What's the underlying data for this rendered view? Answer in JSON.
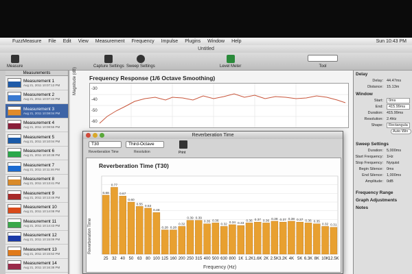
{
  "menubar": {
    "items": [
      "FuzzMeasure",
      "File",
      "Edit",
      "View",
      "Measurement",
      "Frequency",
      "Impulse",
      "Plugins",
      "Window",
      "Help"
    ],
    "clock": "Sun 10:43 PM"
  },
  "window_title": "Untitled",
  "toolbar": {
    "measure": "Measure",
    "capture_settings": "Capture Settings",
    "sweep_settings": "Sweep Settings",
    "level_meter": "Level Meter",
    "tool": "Tool"
  },
  "sidebar": {
    "header": "Measurements",
    "items": [
      {
        "name": "Measurement 1",
        "date": "Aug 21, 2011 10:07:13 PM",
        "color": "#1e5aa8"
      },
      {
        "name": "Measurement 2",
        "date": "Aug 21, 2011 10:07:43 PM",
        "color": "#3a7ad1"
      },
      {
        "name": "Measurement 3",
        "date": "Aug 21, 2011 10:08:04 PM",
        "color": "#e08a2a"
      },
      {
        "name": "Measurement 4",
        "date": "Aug 21, 2011 10:08:55 PM",
        "color": "#8a1f3a"
      },
      {
        "name": "Measurement 5",
        "date": "Aug 21, 2011 10:10:04 PM",
        "color": "#1a5aa8"
      },
      {
        "name": "Measurement 6",
        "date": "Aug 21, 2011 10:10:38 PM",
        "color": "#2aa84a"
      },
      {
        "name": "Measurement 7",
        "date": "Aug 21, 2011 10:11:46 PM",
        "color": "#1a6ad1"
      },
      {
        "name": "Measurement 8",
        "date": "Aug 21, 2011 10:13:41 PM",
        "color": "#d98a2a"
      },
      {
        "name": "Measurement 9",
        "date": "Aug 21, 2011 10:13:46 PM",
        "color": "#a82a2a"
      },
      {
        "name": "Measurement 10",
        "date": "Aug 21, 2011 10:14:08 PM",
        "color": "#d94a1a"
      },
      {
        "name": "Measurement 11",
        "date": "Aug 21, 2011 10:14:43 PM",
        "color": "#3aa84a"
      },
      {
        "name": "Measurement 12",
        "date": "Aug 21, 2011 10:15:09 PM",
        "color": "#1a3aa8"
      },
      {
        "name": "Measurement 13",
        "date": "Aug 21, 2011 10:15:52 PM",
        "color": "#e07a1a"
      },
      {
        "name": "Measurement 14",
        "date": "Aug 21, 2011 10:16:38 PM",
        "color": "#9a2a4a"
      }
    ],
    "selected_index": 2
  },
  "frequency_response": {
    "title": "Frequency Response (1/6 Octave Smoothing)",
    "ylabel": "Magnitude (dB)",
    "ticks": [
      "-30",
      "-40",
      "-50",
      "-60"
    ]
  },
  "right_panel": {
    "delay_header": "Delay",
    "delay": {
      "label": "Delay:",
      "value": "44.47ms"
    },
    "distance": {
      "label": "Distance:",
      "value": "15.13m"
    },
    "window_header": "Window",
    "start": {
      "label": "Start:",
      "value": "0ms"
    },
    "end": {
      "label": "End:",
      "value": "415.99ms"
    },
    "duration": {
      "label": "Duration:",
      "value": "415.99ms"
    },
    "resolution": {
      "label": "Resolution:",
      "value": "2.4Hz"
    },
    "shape": {
      "label": "Shape:",
      "value": "Rectangula"
    },
    "auto_button": "Auto Win",
    "sweep_header": "Sweep Settings",
    "sweep_duration": {
      "label": "Duration:",
      "value": "5,000ms"
    },
    "start_freq": {
      "label": "Start Frequency:",
      "value": "1Hz"
    },
    "stop_freq": {
      "label": "Stop Frequency:",
      "value": "Nyquist"
    },
    "begin_silence": {
      "label": "Begin Silence:",
      "value": "0ms"
    },
    "end_silence": {
      "label": "End Silence:",
      "value": "1,000ms"
    },
    "amplitude": {
      "label": "Amplitude:",
      "value": "0dB"
    },
    "freq_range": "Frequency Range",
    "graph_adj": "Graph Adjustments",
    "notes": "Notes"
  },
  "dialog": {
    "title": "Reverberation Time",
    "metric_select": "T30",
    "metric_label": "Reverberation Time",
    "resolution_select": "Third-Octave",
    "resolution_label": "Resolution",
    "print_label": "Print"
  },
  "chart_data": {
    "type": "bar",
    "title": "Reverberation Time (T30)",
    "xlabel": "Frequency (Hz)",
    "ylabel": "Reverberation Time",
    "categories": [
      "25",
      "32",
      "40",
      "50",
      "63",
      "80",
      "100",
      "125",
      "160",
      "200",
      "250",
      "315",
      "400",
      "500",
      "630",
      "800",
      "1K",
      "1.2K",
      "1.6K",
      "2K",
      "2.5K",
      "3.2K",
      "4K",
      "5K",
      "6.3K",
      "8K",
      "10K",
      "12.5K"
    ],
    "values": [
      0.68,
      0.77,
      0.67,
      0.6,
      0.55,
      0.53,
      0.48,
      0.28,
      0.28,
      0.32,
      0.39,
      0.39,
      0.35,
      0.36,
      0.32,
      0.34,
      0.33,
      0.36,
      0.37,
      0.36,
      0.38,
      0.37,
      0.38,
      0.37,
      0.36,
      0.35,
      0.32,
      0.31
    ],
    "ylim": [
      0,
      0.9
    ],
    "bar_color": "#e8a030",
    "grid": true
  }
}
